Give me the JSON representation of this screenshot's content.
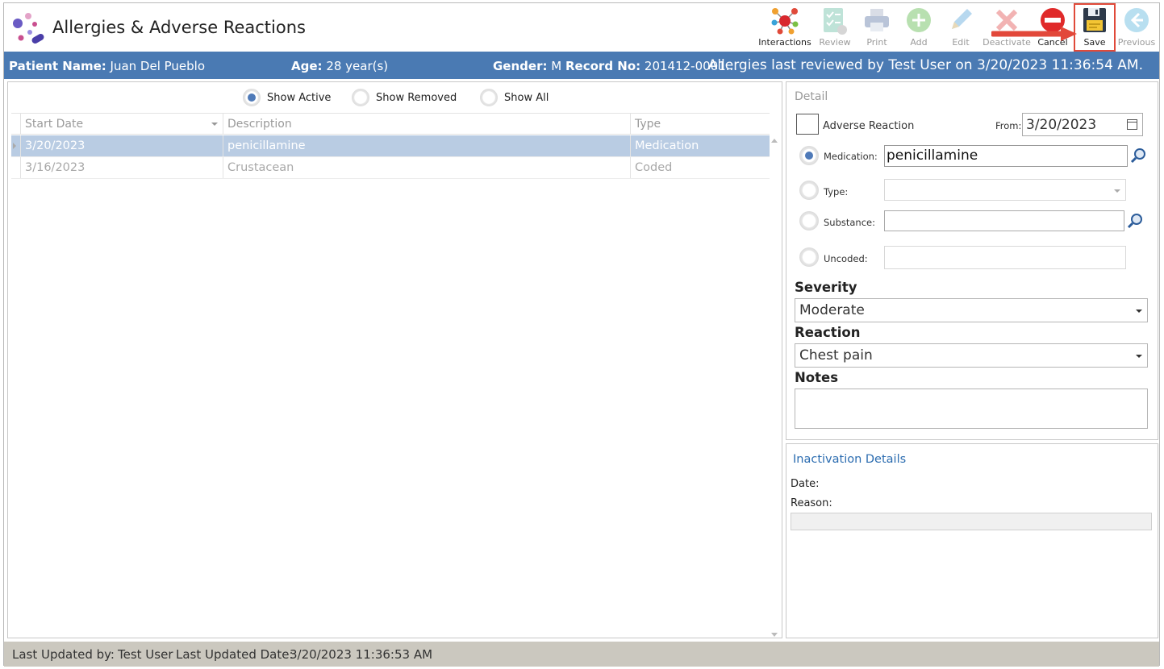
{
  "app": {
    "title": "Allergies & Adverse Reactions"
  },
  "toolbar": {
    "interactions": "Interactions",
    "review": "Review",
    "print": "Print",
    "add": "Add",
    "edit": "Edit",
    "deactivate": "Deactivate",
    "cancel": "Cancel",
    "save": "Save",
    "previous": "Previous",
    "highlight_color": "#e04a3a"
  },
  "patient": {
    "name_label": "Patient Name:",
    "name": "Juan Del Pueblo",
    "age_label": "Age:",
    "age": "28 year(s)",
    "gender_label": "Gender:",
    "gender": "M",
    "record_label": "Record No:",
    "record": "201412-0001...",
    "reviewed": "Allergies last reviewed by Test User on 3/20/2023 11:36:54 AM."
  },
  "filters": {
    "active": "Show Active",
    "removed": "Show Removed",
    "all": "Show All",
    "selected": "Show Active"
  },
  "grid": {
    "columns": [
      "Start Date",
      "Description",
      "Type"
    ],
    "rows": [
      {
        "start": "3/20/2023",
        "description": "penicillamine",
        "type": "Medication",
        "selected": true
      },
      {
        "start": "3/16/2023",
        "description": "Crustacean",
        "type": "Coded",
        "selected": false
      }
    ]
  },
  "detail": {
    "title": "Detail",
    "adverse_reaction": "Adverse Reaction",
    "from_label": "From:",
    "from_value": "3/20/2023",
    "medication_label": "Medication:",
    "medication_value": "penicillamine",
    "type_label": "Type:",
    "substance_label": "Substance:",
    "uncoded_label": "Uncoded:",
    "severity_label": "Severity",
    "severity_value": "Moderate",
    "reaction_label": "Reaction",
    "reaction_value": "Chest pain",
    "notes_label": "Notes"
  },
  "inactivation": {
    "title": "Inactivation Details",
    "date_label": "Date:",
    "reason_label": "Reason:"
  },
  "status": {
    "updated_by_label": "Last Updated by:",
    "updated_by": "Test User",
    "updated_date_label": "Last Updated Date:",
    "updated_date": "3/20/2023 11:36:53 AM"
  },
  "colors": {
    "header_blue": "#4a7ab3",
    "selected_row": "#b9cce3",
    "status_bar": "#cbc8bf",
    "link_blue": "#2b6cb0"
  }
}
